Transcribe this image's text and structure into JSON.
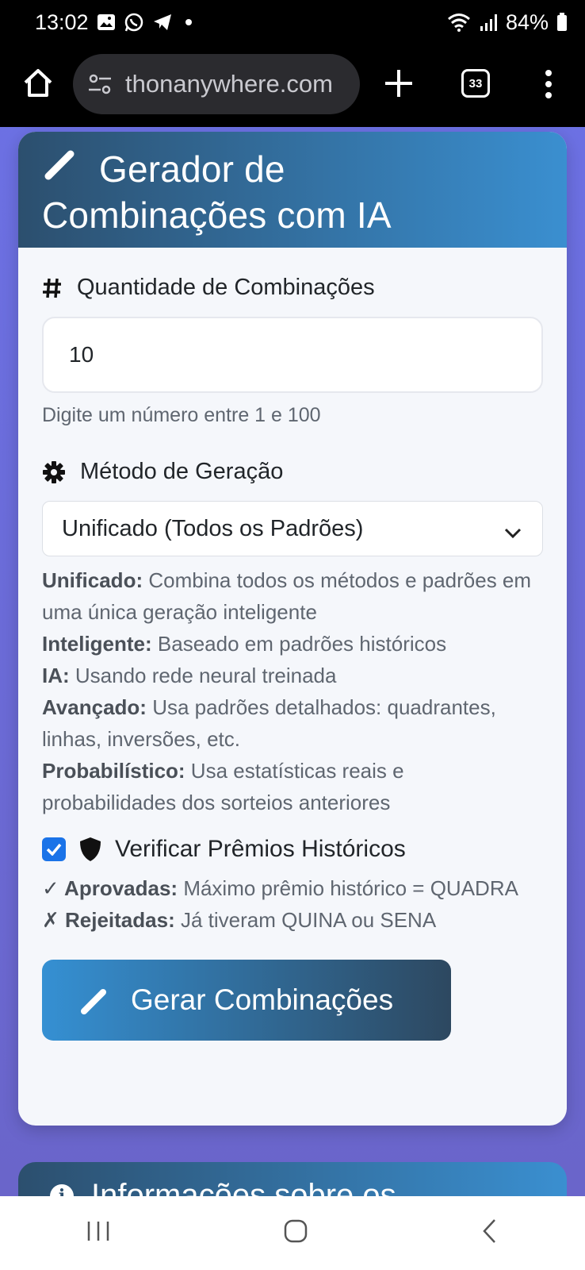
{
  "status": {
    "time": "13:02",
    "battery": "84%"
  },
  "browser": {
    "url": "thonanywhere.com",
    "tabs_count": "33"
  },
  "card": {
    "title_line1": "Gerador de",
    "title_line2": "Combinações com IA",
    "quantity_label": "Quantidade de Combinações",
    "quantity_value": "10",
    "quantity_hint": "Digite um número entre 1 e 100",
    "method_label": "Método de Geração",
    "method_selected": "Unificado (Todos os Padrões)",
    "methods": [
      {
        "name": "Unificado:",
        "desc": " Combina todos os métodos e padrões em uma única geração inteligente"
      },
      {
        "name": "Inteligente:",
        "desc": " Baseado em padrões históricos"
      },
      {
        "name": "IA:",
        "desc": " Usando rede neural treinada"
      },
      {
        "name": "Avançado:",
        "desc": " Usa padrões detalhados: quadrantes, linhas, inversões, etc."
      },
      {
        "name": "Probabilístico:",
        "desc": " Usa estatísticas reais e probabilidades dos sorteios anteriores"
      }
    ],
    "verify_label": "Verificar Prêmios Históricos",
    "verify_checked": true,
    "approved_name": "✓ Aprovadas:",
    "approved_desc": " Máximo prêmio histórico = QUADRA",
    "rejected_name": "✗ Rejeitadas:",
    "rejected_desc": " Já tiveram QUINA ou SENA",
    "generate_button": "Gerar Combinações"
  },
  "card2": {
    "title": "Informações sobre os"
  }
}
